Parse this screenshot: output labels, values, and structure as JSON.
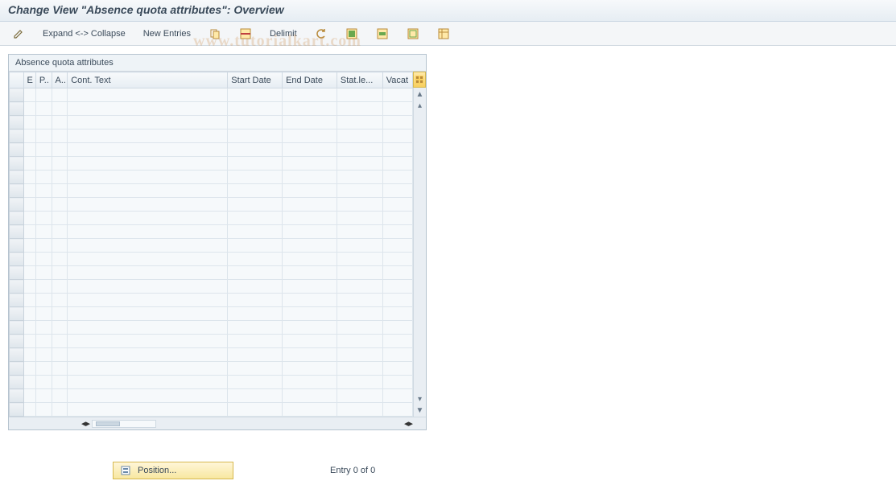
{
  "title": "Change View \"Absence quota attributes\": Overview",
  "toolbar": {
    "expand_collapse": "Expand <-> Collapse",
    "new_entries": "New Entries",
    "delimit": "Delimit"
  },
  "panel": {
    "title": "Absence quota attributes",
    "columns": {
      "rowsel": "",
      "e": "E",
      "p": "P..",
      "a": "A..",
      "cont_text": "Cont. Text",
      "start_date": "Start Date",
      "end_date": "End Date",
      "stat_le": "Stat.le...",
      "vacat": "Vacat"
    },
    "row_count_visible": 24
  },
  "footer": {
    "position_label": "Position...",
    "entry_text": "Entry 0 of 0"
  },
  "watermark": "www.tutorialkart.com"
}
